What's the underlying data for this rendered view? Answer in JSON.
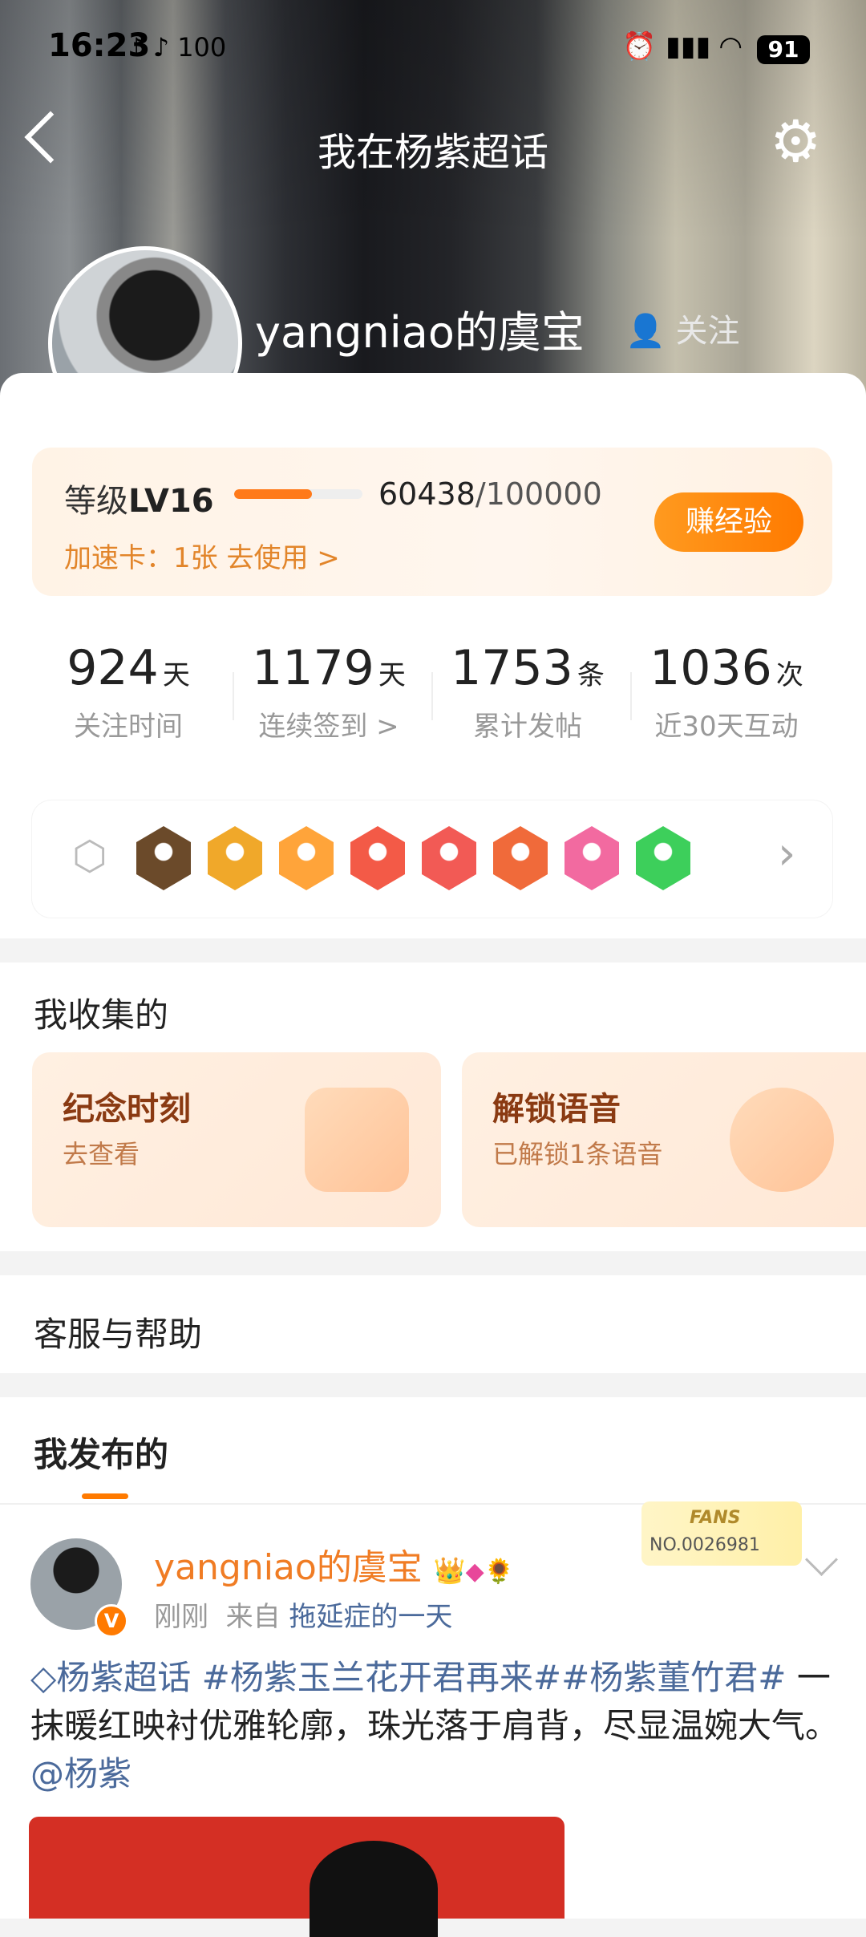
{
  "status": {
    "time": "16:23",
    "left_icons": "♪ ♪ 100",
    "right_icons": "⏰ ▮▮▮ ◠",
    "battery": "91"
  },
  "nav": {
    "title": "我在杨紫超话"
  },
  "profile": {
    "username": "yangniao的虞宝",
    "verified": "V",
    "ghost_text": "关注"
  },
  "level": {
    "label": "等级",
    "level": "LV16",
    "exp_current": "60438",
    "exp_total": "/100000",
    "progress": 0.60438,
    "speed_card": "加速卡：1张 去使用 >",
    "earn_button": "赚经验"
  },
  "stats": [
    {
      "num": "924",
      "unit": "天",
      "label": "关注时间"
    },
    {
      "num": "1179",
      "unit": "天",
      "label": "连续签到 >"
    },
    {
      "num": "1753",
      "unit": "条",
      "label": "累计发帖"
    },
    {
      "num": "1036",
      "unit": "次",
      "label": "近30天互动"
    }
  ],
  "badges": {
    "colors": [
      "#6b4a2a",
      "#f0a82a",
      "#ffa43a",
      "#f35a47",
      "#f25a55",
      "#f06a3a",
      "#f26aa0",
      "#3dcf5b"
    ],
    "more": "›"
  },
  "collections": {
    "title": "我收集的",
    "items": [
      {
        "title": "纪念时刻",
        "sub": "去查看"
      },
      {
        "title": "解锁语音",
        "sub": "已解锁1条语音"
      }
    ]
  },
  "help": {
    "title": "客服与帮助"
  },
  "posts": {
    "tab": "我发布的"
  },
  "post": {
    "author": "yangniao的虞宝",
    "time": "刚刚",
    "from_label": "来自",
    "source": "拖延症的一天",
    "fans_badge": "FANS",
    "fans_no": "NO.0026981",
    "topic1": "◇杨紫超话",
    "topic2": "#杨紫玉兰花开君再来#",
    "topic3": "#杨紫董竹君#",
    "body": "一抹暖红映衬优雅轮廓，珠光落于肩背，尽显温婉大气。",
    "mention": "@杨紫"
  }
}
